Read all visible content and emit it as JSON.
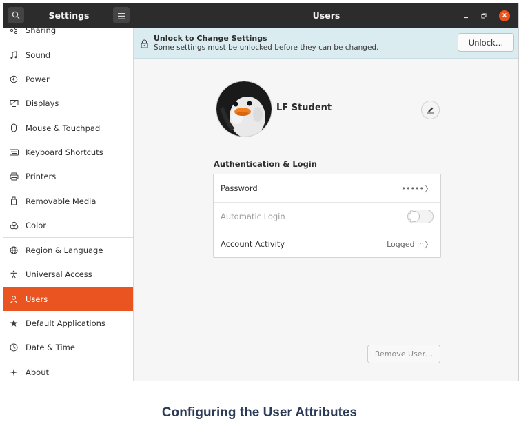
{
  "header": {
    "settings_title": "Settings",
    "panel_title": "Users",
    "search_icon": "search-icon",
    "menu_icon": "hamburger-menu-icon"
  },
  "sidebar": {
    "partial_item": "Sharing",
    "items": [
      {
        "label": "Sound",
        "icon": "music-note-icon"
      },
      {
        "label": "Power",
        "icon": "power-icon"
      },
      {
        "label": "Displays",
        "icon": "display-icon"
      },
      {
        "label": "Mouse & Touchpad",
        "icon": "mouse-icon"
      },
      {
        "label": "Keyboard Shortcuts",
        "icon": "keyboard-icon"
      },
      {
        "label": "Printers",
        "icon": "printer-icon"
      },
      {
        "label": "Removable Media",
        "icon": "usb-drive-icon"
      },
      {
        "label": "Color",
        "icon": "color-icon"
      },
      {
        "label": "Region & Language",
        "icon": "globe-icon"
      },
      {
        "label": "Universal Access",
        "icon": "accessibility-icon"
      },
      {
        "label": "Users",
        "icon": "users-icon",
        "active": true
      },
      {
        "label": "Default Applications",
        "icon": "star-icon"
      },
      {
        "label": "Date & Time",
        "icon": "clock-icon"
      },
      {
        "label": "About",
        "icon": "sparkle-icon"
      }
    ]
  },
  "infobar": {
    "title": "Unlock to Change Settings",
    "message": "Some settings must be unlocked before they can be changed.",
    "unlock_label": "Unlock…"
  },
  "user": {
    "name": "LF Student",
    "avatar": "penguin-avatar"
  },
  "auth": {
    "section_title": "Authentication & Login",
    "rows": [
      {
        "label": "Password",
        "value": "•••••",
        "chevron": "〉"
      },
      {
        "label": "Automatic Login",
        "toggle": false
      },
      {
        "label": "Account Activity",
        "value": "Logged in",
        "chevron": "〉"
      }
    ]
  },
  "remove_user_label": "Remove User…",
  "caption": "Configuring the User Attributes",
  "colors": {
    "accent": "#e95420",
    "header": "#2c2c2c",
    "infobar": "#dbecf1"
  }
}
